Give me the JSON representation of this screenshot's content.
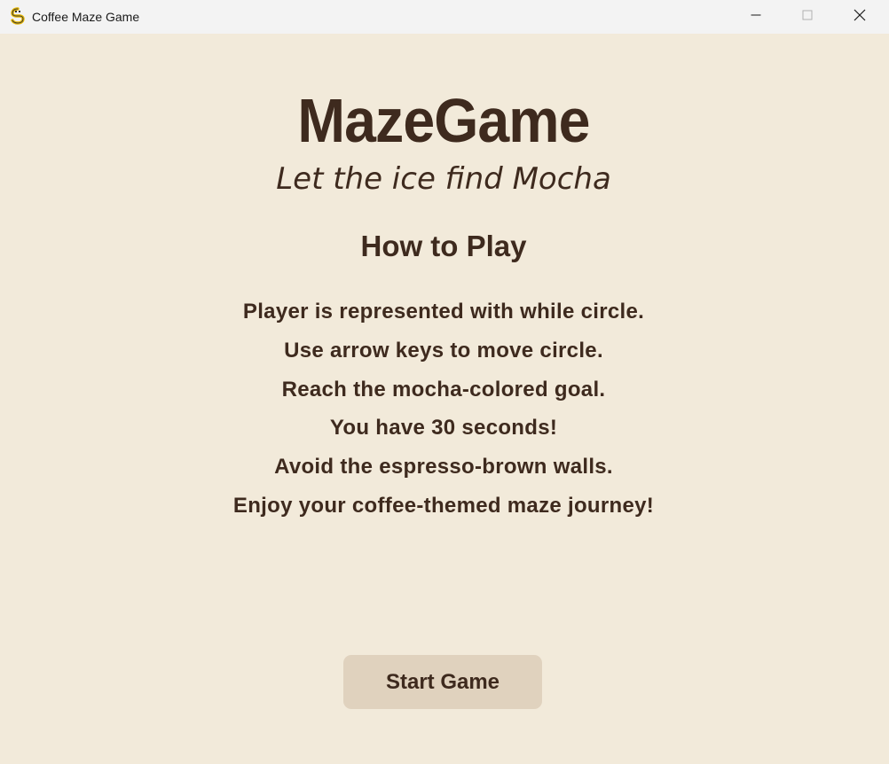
{
  "window": {
    "title": "Coffee Maze Game",
    "app_icon": "pygame-snake-icon",
    "controls": {
      "minimize_icon": "minimize-icon",
      "maximize_icon": "maximize-icon",
      "close_icon": "close-icon"
    }
  },
  "game": {
    "title": "MazeGame",
    "tagline": "Let the ice find Mocha",
    "how_to_play_heading": "How to Play",
    "instructions": [
      "Player is represented with while circle.",
      "Use arrow keys to move circle.",
      "Reach the mocha-colored goal.",
      "You have 30 seconds!",
      "Avoid the espresso-brown walls.",
      "Enjoy your coffee-themed maze journey!"
    ],
    "start_button_label": "Start Game"
  },
  "colors": {
    "background": "#f2eada",
    "text": "#3e2a1e",
    "button": "#e0d2be",
    "titlebar": "#f3f3f3"
  }
}
